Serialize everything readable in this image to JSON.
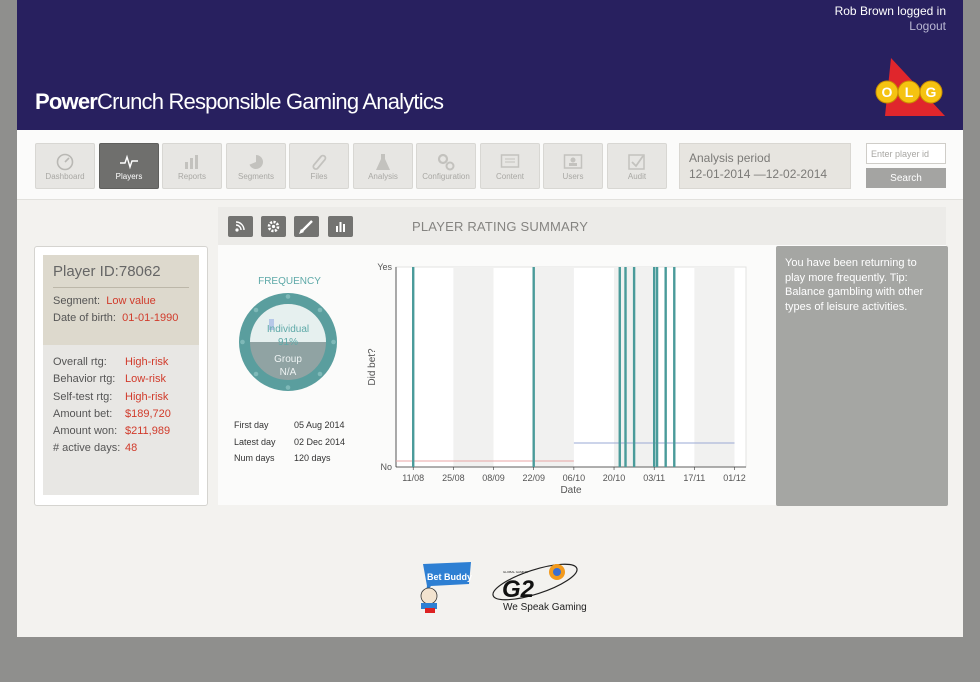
{
  "header": {
    "brand_bold": "Power",
    "brand_rest": "Crunch Responsible Gaming Analytics",
    "user_text": "Rob Brown logged in",
    "logout_label": "Logout",
    "logo_letters": [
      "O",
      "L",
      "G"
    ]
  },
  "nav": {
    "tabs": [
      {
        "label": "Dashboard",
        "icon": "dashboard-icon",
        "active": false
      },
      {
        "label": "Players",
        "icon": "pulse-icon",
        "active": true
      },
      {
        "label": "Reports",
        "icon": "bar-chart-icon",
        "active": false
      },
      {
        "label": "Segments",
        "icon": "pie-icon",
        "active": false
      },
      {
        "label": "Files",
        "icon": "paperclip-icon",
        "active": false
      },
      {
        "label": "Analysis",
        "icon": "flask-icon",
        "active": false
      },
      {
        "label": "Configuration",
        "icon": "gears-icon",
        "active": false
      },
      {
        "label": "Content",
        "icon": "monitor-icon",
        "active": false
      },
      {
        "label": "Users",
        "icon": "users-icon",
        "active": false
      },
      {
        "label": "Audit",
        "icon": "checkbox-icon",
        "active": false
      }
    ],
    "period_title": "Analysis period",
    "period_range": "12-01-2014 —12-02-2014",
    "search_placeholder": "Enter player id",
    "search_label": "Search"
  },
  "profile": {
    "player_id": "Player ID:78062",
    "segment_label": "Segment:",
    "segment_value": "Low value",
    "dob_label": "Date of birth:",
    "dob_value": "01-01-1990",
    "overall_label": "Overall rtg:",
    "overall_value": "High-risk",
    "behavior_label": "Behavior rtg:",
    "behavior_value": "Low-risk",
    "selftest_label": "Self-test rtg:",
    "selftest_value": "High-risk",
    "bet_label": "Amount bet:",
    "bet_value": "$189,720",
    "won_label": "Amount won:",
    "won_value": "$211,989",
    "days_label": "# active days:",
    "days_value": "48"
  },
  "summary": {
    "title": "PLAYER RATING SUMMARY",
    "toolbar_icons": [
      "rss-icon",
      "gear-icon",
      "pen-icon",
      "bar-chart-icon"
    ],
    "frequency_title": "FREQUENCY",
    "individual_label": "Individual",
    "individual_value": "91%",
    "individual_fraction": 0.91,
    "group_label": "Group",
    "group_value": "N/A",
    "first_day_label": "First day",
    "first_day_value": "05 Aug 2014",
    "latest_day_label": "Latest day",
    "latest_day_value": "02 Dec 2014",
    "num_days_label": "Num days",
    "num_days_value": "120 days"
  },
  "chart_data": {
    "type": "bar",
    "ylabel": "Did bet?",
    "xlabel": "Date",
    "y_categories": [
      "No",
      "Yes"
    ],
    "x_ticks": [
      "11/08",
      "25/08",
      "08/09",
      "22/09",
      "06/10",
      "20/10",
      "03/11",
      "17/11",
      "01/12"
    ],
    "x_range": [
      "2014-08-05",
      "2014-12-05"
    ],
    "bet_days": [
      "2014-08-11",
      "2014-09-22",
      "2014-10-22",
      "2014-10-24",
      "2014-10-27",
      "2014-11-03",
      "2014-11-04",
      "2014-11-07",
      "2014-11-10"
    ],
    "trend_lines": [
      {
        "from": "2014-08-05",
        "to": "2014-10-06",
        "value": 0.03,
        "color": "#e8a5a5"
      },
      {
        "from": "2014-10-06",
        "to": "2014-12-01",
        "value": 0.12,
        "color": "#9aa9d4"
      }
    ],
    "bar_color": "#4a9b9a"
  },
  "tip": {
    "text": "You have been returning to play more frequently. Tip: Balance gambling with other types of leisure activities."
  },
  "footer": {
    "betbuddy_text": "Bet Buddy",
    "g2_text": "G2",
    "g2_small": "GLOBAL GAMING",
    "tagline": "We Speak Gaming"
  },
  "colors": {
    "header_bg": "#28205f",
    "risk_text": "#d13b2b",
    "teal": "#4a9b9a"
  }
}
